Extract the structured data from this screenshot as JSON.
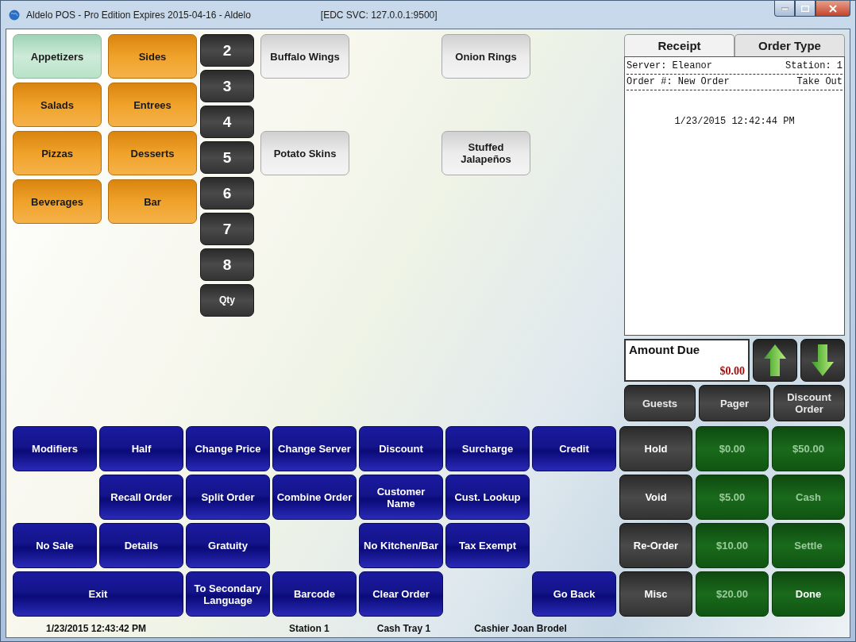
{
  "window": {
    "title": "Aldelo POS - Pro Edition Expires 2015-04-16  - Aldelo",
    "service": "[EDC SVC: 127.0.0.1:9500]"
  },
  "categories": [
    {
      "label": "Appetizers",
      "selected": true
    },
    {
      "label": "Sides",
      "selected": false
    },
    {
      "label": "Salads",
      "selected": false
    },
    {
      "label": "Entrees",
      "selected": false
    },
    {
      "label": "Pizzas",
      "selected": false
    },
    {
      "label": "Desserts",
      "selected": false
    },
    {
      "label": "Beverages",
      "selected": false
    },
    {
      "label": "Bar",
      "selected": false
    }
  ],
  "quantity_keys": [
    "2",
    "3",
    "4",
    "5",
    "6",
    "7",
    "8",
    "Qty"
  ],
  "menu_items": [
    {
      "kind": "item",
      "label": "Buffalo Wings"
    },
    {
      "kind": "blank"
    },
    {
      "kind": "item",
      "label": "Potato Skins"
    },
    {
      "kind": "blank"
    },
    {
      "kind": "blank"
    },
    {
      "kind": "blank"
    },
    {
      "kind": "item",
      "label": "Onion Rings"
    },
    {
      "kind": "blank"
    },
    {
      "kind": "item",
      "label": "Stuffed Jalapeños"
    },
    {
      "kind": "blank"
    },
    {
      "kind": "blank"
    },
    {
      "kind": "blank"
    }
  ],
  "receipt": {
    "tabs": [
      {
        "label": "Receipt",
        "selected": true
      },
      {
        "label": "Order Type",
        "selected": false
      }
    ],
    "server": "Server: Eleanor",
    "station": "Station: 1",
    "order": "Order #: New Order",
    "order_type": "Take Out",
    "timestamp": "1/23/2015 12:42:44 PM",
    "amount_due_label": "Amount Due",
    "amount_due": "$0.00",
    "actions": [
      "Guests",
      "Pager",
      "Discount Order"
    ]
  },
  "function_buttons": [
    {
      "kind": "normal",
      "label": "Modifiers"
    },
    {
      "kind": "normal",
      "label": "Half"
    },
    {
      "kind": "normal",
      "label": "Change Price"
    },
    {
      "kind": "normal",
      "label": "Change Server"
    },
    {
      "kind": "normal",
      "label": "Discount"
    },
    {
      "kind": "normal",
      "label": "Surcharge"
    },
    {
      "kind": "normal",
      "label": "Credit"
    },
    {
      "kind": "blank"
    },
    {
      "kind": "normal",
      "label": "Recall Order"
    },
    {
      "kind": "normal",
      "label": "Split Order"
    },
    {
      "kind": "normal",
      "label": "Combine Order"
    },
    {
      "kind": "normal",
      "label": "Customer Name"
    },
    {
      "kind": "normal",
      "label": "Cust. Lookup"
    },
    {
      "kind": "blank"
    },
    {
      "kind": "normal",
      "label": "No Sale"
    },
    {
      "kind": "normal",
      "label": "Details"
    },
    {
      "kind": "normal",
      "label": "Gratuity"
    },
    {
      "kind": "blank"
    },
    {
      "kind": "normal",
      "label": "No Kitchen/Bar"
    },
    {
      "kind": "normal",
      "label": "Tax Exempt"
    },
    {
      "kind": "blank"
    },
    {
      "kind": "wide",
      "label": "Exit"
    },
    {
      "kind": "normal",
      "label": "To Secondary Language"
    },
    {
      "kind": "normal",
      "label": "Barcode"
    },
    {
      "kind": "normal",
      "label": "Clear Order"
    },
    {
      "kind": "blank"
    },
    {
      "kind": "normal",
      "label": "Go Back"
    }
  ],
  "payment_buttons": [
    {
      "kind": "dark",
      "label": "Hold",
      "disabled": false
    },
    {
      "kind": "green",
      "label": "$0.00",
      "disabled": true
    },
    {
      "kind": "green",
      "label": "$50.00",
      "disabled": true
    },
    {
      "kind": "dark",
      "label": "Void",
      "disabled": false
    },
    {
      "kind": "green",
      "label": "$5.00",
      "disabled": true
    },
    {
      "kind": "green",
      "label": "Cash",
      "disabled": true
    },
    {
      "kind": "dark",
      "label": "Re-Order",
      "disabled": false
    },
    {
      "kind": "green",
      "label": "$10.00",
      "disabled": true
    },
    {
      "kind": "green",
      "label": "Settle",
      "disabled": true
    },
    {
      "kind": "dark",
      "label": "Misc",
      "disabled": false
    },
    {
      "kind": "green",
      "label": "$20.00",
      "disabled": true
    },
    {
      "kind": "green",
      "label": "Done",
      "disabled": false
    }
  ],
  "status_bar": [
    "1/23/2015 12:43:42 PM",
    "Station 1",
    "Cash Tray 1",
    "Cashier Joan Brodel"
  ]
}
